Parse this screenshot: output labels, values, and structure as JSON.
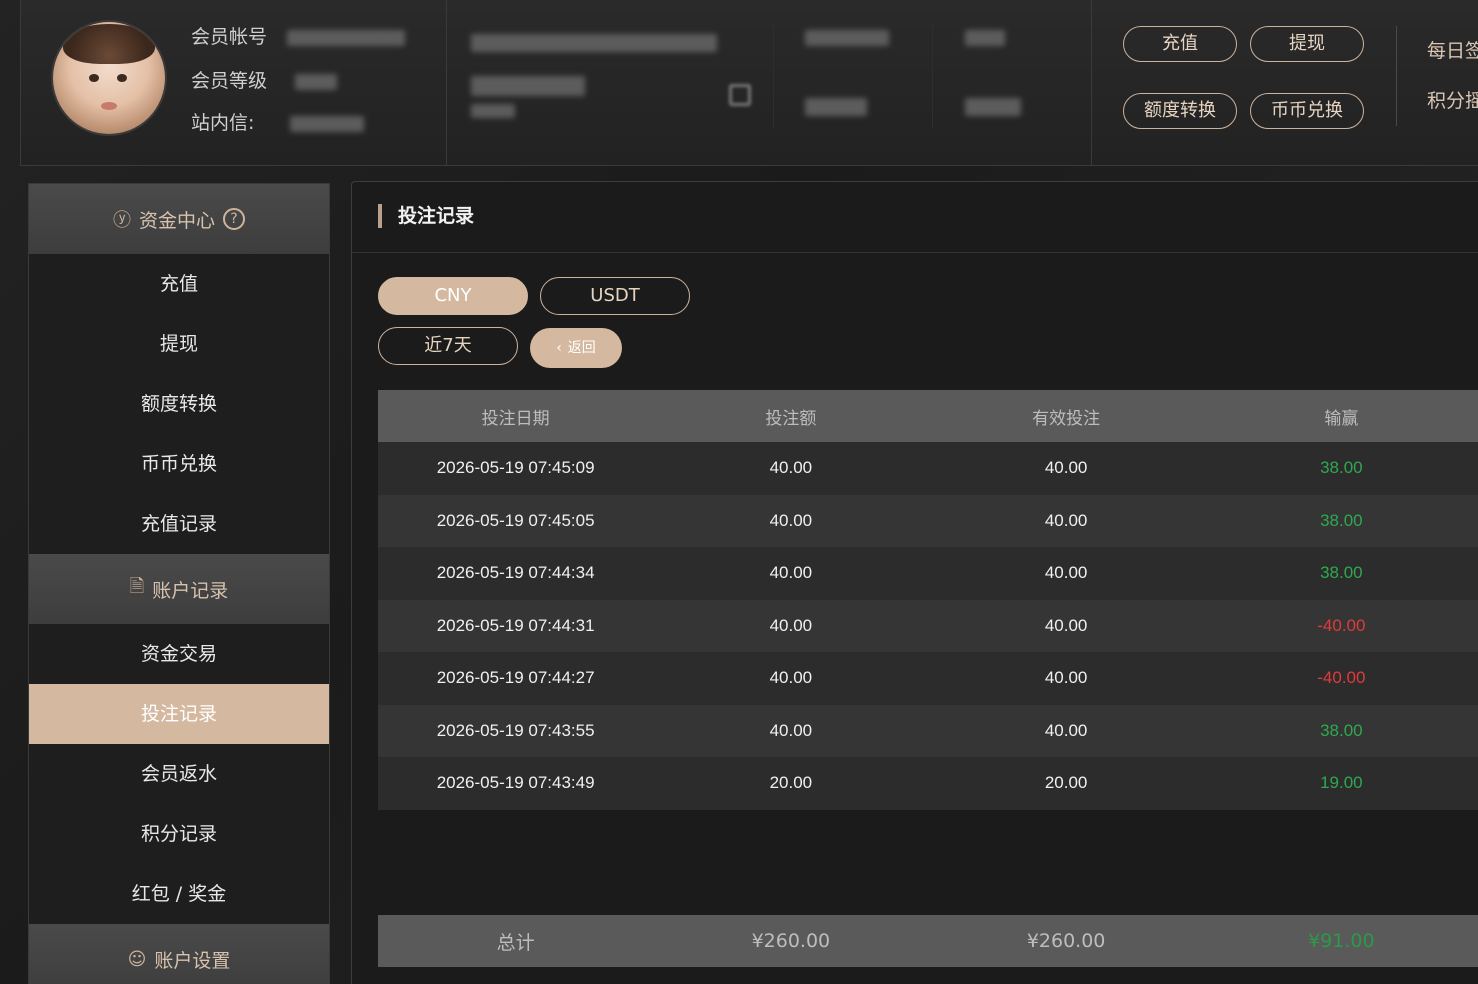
{
  "header": {
    "account_label": "会员帐号",
    "level_label": "会员等级",
    "message_label": "站内信:",
    "buttons": {
      "deposit": "充值",
      "withdraw": "提现",
      "transfer": "额度转换",
      "exchange": "币币兑换"
    },
    "right_links": {
      "daily_sign": "每日签",
      "points": "积分摇"
    }
  },
  "sidebar": {
    "sections": [
      {
        "title": "资金中心",
        "items": [
          "充值",
          "提现",
          "额度转换",
          "币币兑换",
          "充值记录"
        ]
      },
      {
        "title": "账户记录",
        "items": [
          "资金交易",
          "投注记录",
          "会员返水",
          "积分记录",
          "红包 / 奖金"
        ]
      },
      {
        "title": "账户设置",
        "items": []
      }
    ],
    "active_item": "投注记录"
  },
  "panel": {
    "title": "投注记录",
    "currency_tabs": [
      "CNY",
      "USDT"
    ],
    "active_currency": "CNY",
    "range_label": "近7天",
    "back_label": "返回"
  },
  "table": {
    "headers": [
      "投注日期",
      "投注额",
      "有效投注",
      "输赢"
    ],
    "rows": [
      {
        "date": "2026-05-19 07:45:09",
        "amount": "40.00",
        "valid": "40.00",
        "win": "38.00",
        "win_sign": "pos"
      },
      {
        "date": "2026-05-19 07:45:05",
        "amount": "40.00",
        "valid": "40.00",
        "win": "38.00",
        "win_sign": "pos"
      },
      {
        "date": "2026-05-19 07:44:34",
        "amount": "40.00",
        "valid": "40.00",
        "win": "38.00",
        "win_sign": "pos"
      },
      {
        "date": "2026-05-19 07:44:31",
        "amount": "40.00",
        "valid": "40.00",
        "win": "-40.00",
        "win_sign": "neg"
      },
      {
        "date": "2026-05-19 07:44:27",
        "amount": "40.00",
        "valid": "40.00",
        "win": "-40.00",
        "win_sign": "neg"
      },
      {
        "date": "2026-05-19 07:43:55",
        "amount": "40.00",
        "valid": "40.00",
        "win": "38.00",
        "win_sign": "pos"
      },
      {
        "date": "2026-05-19 07:43:49",
        "amount": "20.00",
        "valid": "20.00",
        "win": "19.00",
        "win_sign": "pos"
      }
    ],
    "footer": {
      "label": "总计",
      "amount": "¥260.00",
      "valid": "¥260.00",
      "win": "¥91.00"
    }
  },
  "colors": {
    "accent": "#d4b8a0",
    "positive": "#2fa84f",
    "negative": "#e03b3b"
  }
}
